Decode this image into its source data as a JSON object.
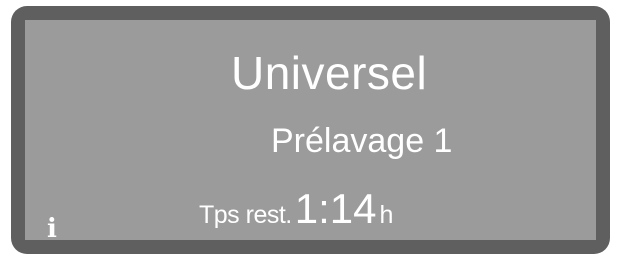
{
  "display": {
    "program_name": "Universel",
    "phase": "Prélavage 1",
    "remaining_label": "Tps rest.",
    "remaining_time": "1:14",
    "remaining_unit": "h",
    "info_symbol": "i"
  },
  "colors": {
    "bezel": "#5f5f5f",
    "screen": "#9b9b9b",
    "text": "#ffffff"
  },
  "icons": {
    "info": "info-icon"
  }
}
